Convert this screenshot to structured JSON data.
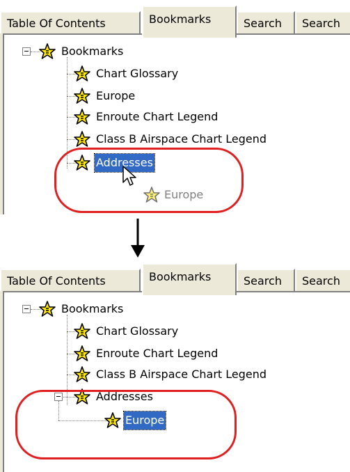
{
  "tabs": [
    "Table Of Contents",
    "Bookmarks",
    "Search",
    "Search"
  ],
  "before": {
    "root": "Bookmarks",
    "items": [
      "Chart Glossary",
      "Europe",
      "Enroute Chart Legend",
      "Class B Airspace Chart Legend",
      "Addresses"
    ],
    "dragged": "Europe"
  },
  "after": {
    "root": "Bookmarks",
    "items": [
      "Chart Glossary",
      "Enroute Chart Legend",
      "Class B Airspace Chart Legend",
      "Addresses"
    ],
    "child": "Europe"
  },
  "colors": {
    "highlight_ring": "#e02020",
    "selection": "#316ac5",
    "star_fill": "#ffe800"
  },
  "icons": {
    "bookmark": "star-bookmark-icon",
    "expander": "tree-collapse-icon",
    "cursor": "mouse-pointer-icon",
    "transition": "down-arrow-icon"
  }
}
